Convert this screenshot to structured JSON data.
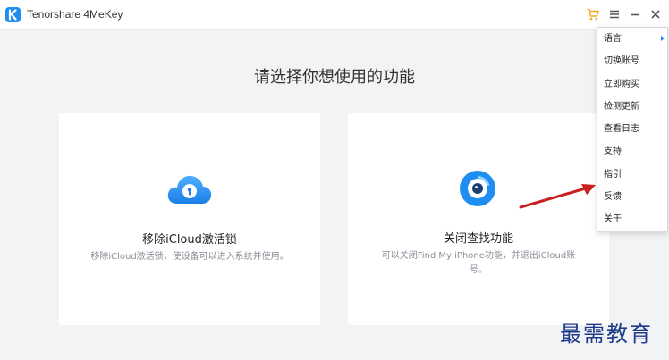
{
  "app": {
    "title": "Tenorshare 4MeKey"
  },
  "titlebar": {
    "icons": [
      "cart-icon",
      "hamburger-menu-icon",
      "minimize-icon",
      "close-icon"
    ],
    "accent": "#f5a623"
  },
  "main": {
    "heading": "请选择你想使用的功能",
    "cards": [
      {
        "title": "移除iCloud激活锁",
        "description": "移除iCloud激活锁，使设备可以进入系统并使用。",
        "icon": "cloud-lock-icon"
      },
      {
        "title": "关闭查找功能",
        "description_line1": "可以关闭Find My iPhone功能，并退出iCloud账",
        "description_line2": "号。",
        "icon": "find-my-icon"
      }
    ]
  },
  "menu": {
    "items": [
      {
        "label": "语言",
        "has_submenu": true
      },
      {
        "label": "切换账号"
      },
      {
        "label": "立即购买"
      },
      {
        "label": "检测更新"
      },
      {
        "label": "查看日志"
      },
      {
        "label": "支持"
      },
      {
        "label": "指引"
      },
      {
        "label": "反馈"
      },
      {
        "label": "关于"
      }
    ]
  },
  "watermark": {
    "text": "最需教育"
  },
  "colors": {
    "brand": "#1f8ef1",
    "annotation_arrow": "#c8201e",
    "background": "#f2f3f5"
  }
}
